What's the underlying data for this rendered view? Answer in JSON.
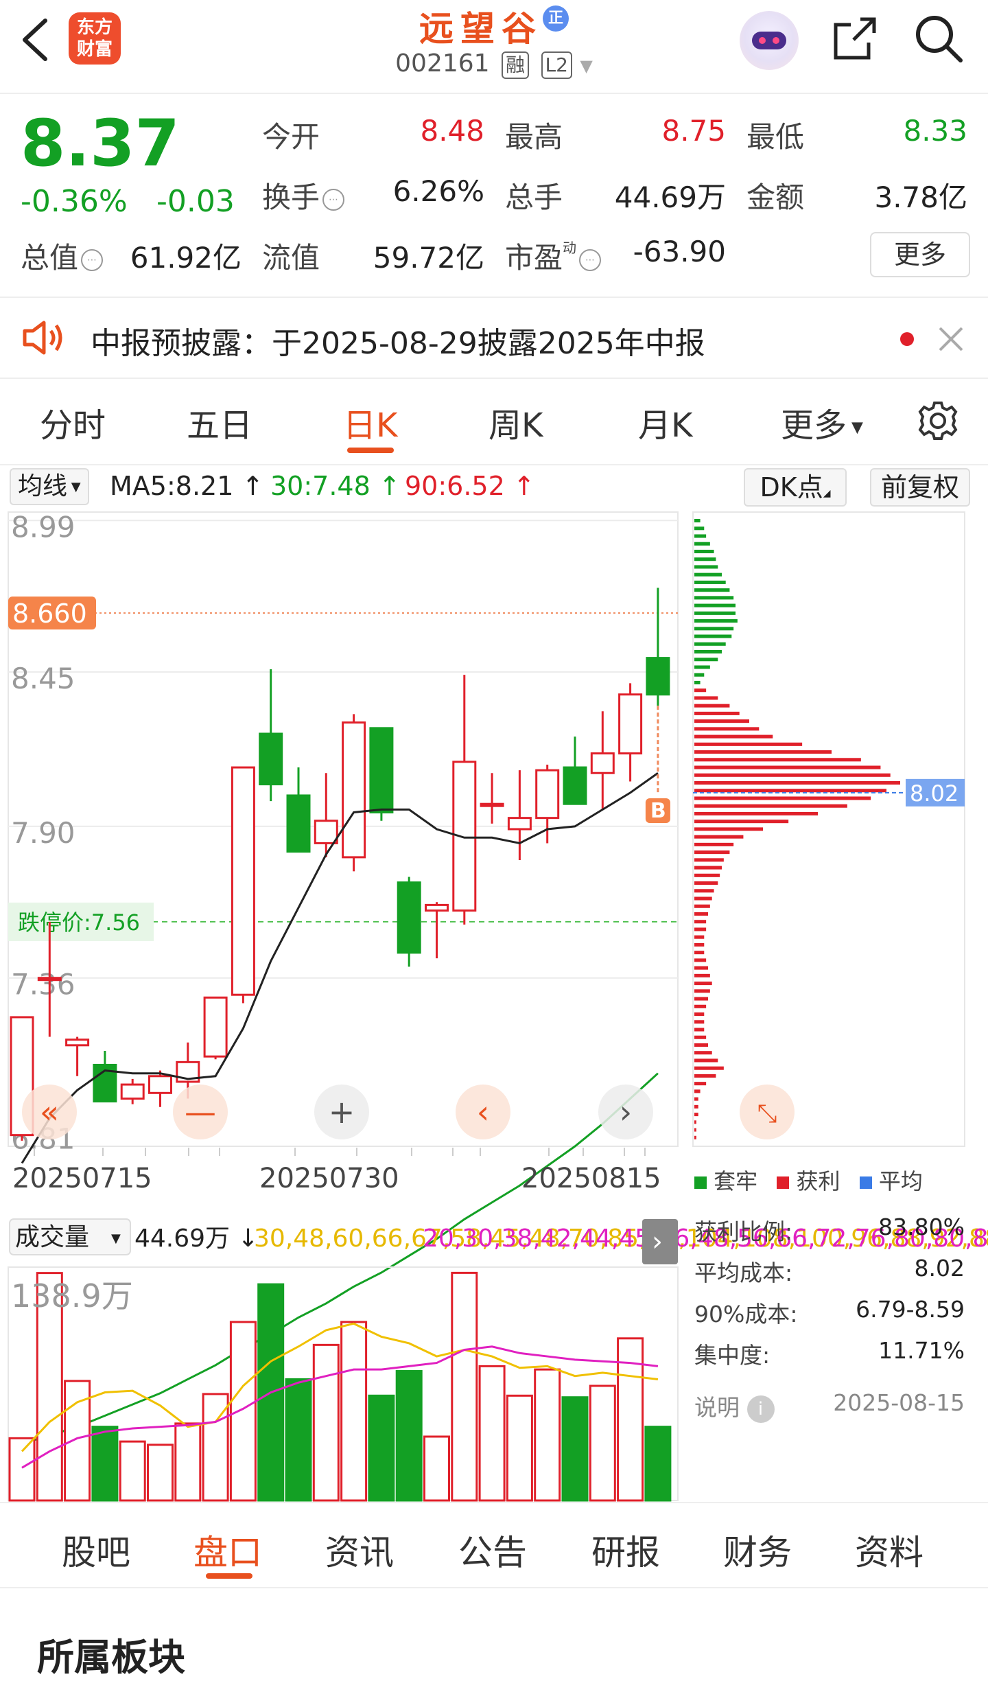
{
  "header": {
    "logo_text": "东方\n财富",
    "stock_name": "远望谷",
    "badge": "正",
    "code": "002161",
    "tag1": "融",
    "tag2": "L2"
  },
  "quote": {
    "price": "8.37",
    "change_pct": "-0.36%",
    "change": "-0.03",
    "open_label": "今开",
    "open": "8.48",
    "high_label": "最高",
    "high": "8.75",
    "low_label": "最低",
    "low": "8.33",
    "turnover_label": "换手",
    "turnover": "6.26%",
    "volume_label": "总手",
    "volume": "44.69万",
    "amount_label": "金额",
    "amount": "3.78亿",
    "mcap_label": "总值",
    "mcap": "61.92亿",
    "float_label": "流值",
    "float": "59.72亿",
    "pe_label": "市盈",
    "pe_sup": "动",
    "pe": "-63.90",
    "more": "更多"
  },
  "notice": {
    "text": "中报预披露：于2025-08-29披露2025年中报"
  },
  "tabs": [
    "分时",
    "五日",
    "日K",
    "周K",
    "月K",
    "更多"
  ],
  "active_tab": "日K",
  "ma_bar": {
    "selector": "均线",
    "ma5": "MA5:8.21",
    "ma30": "30:7.48",
    "ma90": "90:6.52",
    "dk_btn": "DK点",
    "adj_btn": "前复权"
  },
  "chart_data": {
    "type": "candlestick",
    "y_ticks": [
      "8.99",
      "8.45",
      "7.90",
      "7.36",
      "6.81"
    ],
    "x_ticks": [
      "20250715",
      "20250730",
      "20250815"
    ],
    "current_line_label": "8.660",
    "limit_down_label": "跌停价:7.56",
    "avg_cost_label": "8.02",
    "signal": "B",
    "candles": [
      {
        "o": 6.8,
        "h": 7.22,
        "l": 6.78,
        "c": 7.22
      },
      {
        "o": 7.36,
        "h": 7.56,
        "l": 7.15,
        "c": 7.36
      },
      {
        "o": 7.12,
        "h": 7.15,
        "l": 7.01,
        "c": 7.14
      },
      {
        "o": 7.05,
        "h": 7.1,
        "l": 6.96,
        "c": 6.92
      },
      {
        "o": 6.93,
        "h": 7.0,
        "l": 6.91,
        "c": 6.98
      },
      {
        "o": 6.95,
        "h": 7.03,
        "l": 6.9,
        "c": 7.01
      },
      {
        "o": 6.99,
        "h": 7.13,
        "l": 6.93,
        "c": 7.06
      },
      {
        "o": 7.08,
        "h": 7.29,
        "l": 7.07,
        "c": 7.29
      },
      {
        "o": 7.3,
        "h": 8.11,
        "l": 7.27,
        "c": 8.11
      },
      {
        "o": 8.23,
        "h": 8.46,
        "l": 7.99,
        "c": 8.05
      },
      {
        "o": 8.01,
        "h": 8.11,
        "l": 7.85,
        "c": 7.81
      },
      {
        "o": 7.84,
        "h": 8.09,
        "l": 7.79,
        "c": 7.92
      },
      {
        "o": 7.79,
        "h": 8.3,
        "l": 7.74,
        "c": 8.27
      },
      {
        "o": 8.25,
        "h": 8.25,
        "l": 7.92,
        "c": 7.95
      },
      {
        "o": 7.7,
        "h": 7.72,
        "l": 7.4,
        "c": 7.45
      },
      {
        "o": 7.6,
        "h": 7.63,
        "l": 7.43,
        "c": 7.62
      },
      {
        "o": 7.6,
        "h": 8.44,
        "l": 7.55,
        "c": 8.13
      },
      {
        "o": 7.98,
        "h": 8.09,
        "l": 7.91,
        "c": 7.98
      },
      {
        "o": 7.89,
        "h": 8.1,
        "l": 7.78,
        "c": 7.93
      },
      {
        "o": 7.93,
        "h": 8.12,
        "l": 7.84,
        "c": 8.1
      },
      {
        "o": 8.11,
        "h": 8.22,
        "l": 7.98,
        "c": 7.98
      },
      {
        "o": 8.09,
        "h": 8.31,
        "l": 7.96,
        "c": 8.16
      },
      {
        "o": 8.16,
        "h": 8.41,
        "l": 8.06,
        "c": 8.37
      },
      {
        "o": 8.5,
        "h": 8.75,
        "l": 8.33,
        "c": 8.37
      }
    ],
    "ma5": [
      6.7,
      6.86,
      6.96,
      7.03,
      7.02,
      7.02,
      7.0,
      7.01,
      7.18,
      7.42,
      7.61,
      7.8,
      7.95,
      7.96,
      7.96,
      7.89,
      7.86,
      7.86,
      7.84,
      7.89,
      7.9,
      7.96,
      8.02,
      8.09
    ],
    "ma30": [
      5.7,
      5.73,
      5.76,
      5.8,
      5.84,
      5.88,
      5.93,
      5.98,
      6.04,
      6.09,
      6.15,
      6.2,
      6.26,
      6.31,
      6.37,
      6.43,
      6.5,
      6.56,
      6.62,
      6.69,
      6.76,
      6.84,
      6.93,
      7.02
    ],
    "volume": {
      "label": "成交量",
      "value": "44.69万",
      "ma1": [
        30,
        48,
        60,
        66,
        67,
        58,
        45,
        48,
        70,
        85,
        94,
        104,
        108,
        100,
        96,
        88,
        92,
        88,
        81,
        82,
        76,
        78,
        76,
        74
      ],
      "ma2": [
        20,
        30,
        38,
        42,
        44,
        45,
        46,
        48,
        56,
        66,
        72,
        76,
        80,
        80,
        82,
        84,
        92,
        94,
        90,
        88,
        86,
        85,
        84,
        82
      ],
      "max_label": "138.9万",
      "bars": [
        38,
        138.9,
        73,
        45,
        36,
        34,
        47,
        65,
        109,
        132,
        74,
        95,
        109,
        64,
        79,
        39,
        139,
        82,
        64,
        80,
        63,
        70,
        99,
        45
      ]
    },
    "chip": {
      "legend": [
        "套牢",
        "获利",
        "平均"
      ],
      "profit_ratio_label": "获利比例:",
      "profit_ratio": "83.80%",
      "avg_cost_label": "平均成本:",
      "avg_cost": "8.02",
      "cost90_label": "90%成本:",
      "cost90": "6.79-8.59",
      "concentration_label": "集中度:",
      "concentration": "11.71%",
      "note_label": "说明",
      "date": "2025-08-15",
      "bars": [
        3,
        5,
        6,
        8,
        10,
        11,
        12,
        14,
        16,
        18,
        20,
        21,
        21,
        22,
        20,
        19,
        16,
        14,
        12,
        8,
        5,
        3,
        6,
        12,
        18,
        23,
        28,
        33,
        40,
        55,
        70,
        85,
        95,
        100,
        105,
        98,
        90,
        78,
        63,
        48,
        35,
        25,
        20,
        18,
        15,
        14,
        13,
        12,
        10,
        9,
        8,
        7,
        6,
        6,
        5,
        5,
        5,
        6,
        7,
        8,
        9,
        8,
        7,
        6,
        5,
        5,
        5,
        6,
        7,
        9,
        12,
        15,
        11,
        6,
        3,
        2,
        2,
        2,
        1,
        1,
        1
      ]
    },
    "colors": {
      "up": "#e0202a",
      "down": "#13a024",
      "ma5": "#222222",
      "ma30": "#13a024",
      "vol_ma1": "#f0c000",
      "vol_ma2": "#e020c0",
      "accent": "#e8501e",
      "avg": "#3a7be6"
    }
  },
  "bottom_tabs": [
    "股吧",
    "盘口",
    "资讯",
    "公告",
    "研报",
    "财务",
    "资料"
  ],
  "active_bottom_tab": "盘口",
  "next_section_title": "所属板块",
  "icons": [
    "back-icon",
    "robot-avatar-icon",
    "share-icon",
    "search-icon",
    "speaker-icon",
    "close-icon",
    "settings-gear-icon",
    "info-icon",
    "rewind-icon",
    "zoom-out-icon",
    "zoom-in-icon",
    "prev-icon",
    "next-icon",
    "expand-icon",
    "arrow-right-icon"
  ]
}
